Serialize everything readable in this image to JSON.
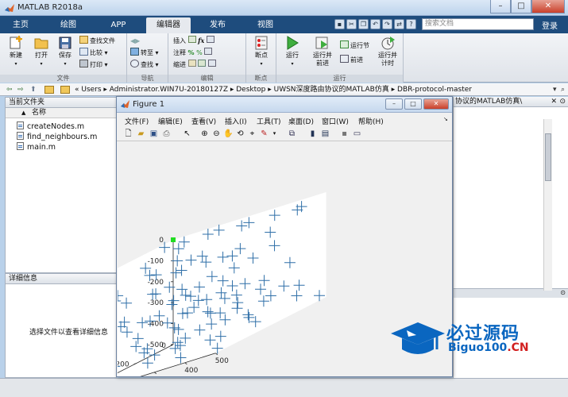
{
  "window": {
    "title": "MATLAB R2018a"
  },
  "tabs": [
    {
      "label": "主页"
    },
    {
      "label": "绘图"
    },
    {
      "label": "APP"
    },
    {
      "label": "编辑器"
    },
    {
      "label": "发布"
    },
    {
      "label": "视图"
    }
  ],
  "search": {
    "placeholder": "搜索文档"
  },
  "login_label": "登录",
  "ribbon": {
    "file_group": {
      "label": "文件",
      "new_label": "新建",
      "open_label": "打开",
      "save_label": "保存",
      "find_files_label": "查找文件",
      "compare_label": "比较",
      "print_label": "打印"
    },
    "nav_group": {
      "label": "导航",
      "goto_label": "转至",
      "find_label": "查找"
    },
    "edit_group": {
      "label": "编辑",
      "insert_label": "插入",
      "comment_label": "注释",
      "indent_label": "缩进"
    },
    "breakpoints_group": {
      "label": "断点",
      "breakpoints_label": "断点"
    },
    "run_group": {
      "label": "运行",
      "run_label": "运行",
      "run_advance_label": "运行并\n前进",
      "run_section_label": "运行节",
      "advance_label": "前进",
      "run_time_label": "运行并\n计时"
    }
  },
  "address": {
    "path": "« Users ▸ Administrator.WIN7U-20180127Z ▸ Desktop ▸ UWSN深度路由协议的MATLAB仿真 ▸ DBR-protocol-master"
  },
  "current_folder": {
    "title": "当前文件夹",
    "column_name": "名称",
    "sort_indicator": "▲",
    "files": [
      "createNodes.m",
      "find_neighbours.m",
      "main.m"
    ]
  },
  "details": {
    "title": "详细信息",
    "hint": "选择文件以查看详细信息"
  },
  "editor": {
    "tab_title": "协议的MATLAB仿真\\"
  },
  "figure": {
    "title": "Figure 1",
    "menu": [
      "文件(F)",
      "编辑(E)",
      "查看(V)",
      "插入(I)",
      "工具(T)",
      "桌面(D)",
      "窗口(W)",
      "帮助(H)"
    ]
  },
  "chart_data": {
    "type": "scatter",
    "projection": "3d",
    "marker": "+",
    "color": "#2f6fa8",
    "highlight_color": "#22dd22",
    "axes": {
      "x": {
        "ticks": [
          0,
          100,
          200,
          300,
          400,
          500
        ],
        "range": [
          0,
          500
        ]
      },
      "y": {
        "ticks": [
          0,
          200,
          400,
          600
        ],
        "range": [
          0,
          600
        ]
      },
      "z": {
        "ticks": [
          0,
          -100,
          -200,
          -300,
          -400,
          -500
        ],
        "range": [
          -500,
          0
        ]
      }
    },
    "grid": false,
    "points": [
      [
        20,
        80,
        -10
      ],
      [
        60,
        40,
        -20
      ],
      [
        90,
        120,
        -30
      ],
      [
        150,
        60,
        -15
      ],
      [
        210,
        100,
        -5
      ],
      [
        260,
        60,
        -25
      ],
      [
        320,
        120,
        -10
      ],
      [
        380,
        80,
        -20
      ],
      [
        430,
        40,
        -35
      ],
      [
        480,
        100,
        -15
      ],
      [
        30,
        200,
        -60
      ],
      [
        80,
        260,
        -90
      ],
      [
        140,
        210,
        -70
      ],
      [
        190,
        300,
        -110
      ],
      [
        240,
        240,
        -80
      ],
      [
        300,
        320,
        -100
      ],
      [
        350,
        260,
        -120
      ],
      [
        400,
        300,
        -90
      ],
      [
        450,
        220,
        -70
      ],
      [
        500,
        280,
        -130
      ],
      [
        40,
        380,
        -140
      ],
      [
        100,
        420,
        -160
      ],
      [
        160,
        360,
        -170
      ],
      [
        210,
        460,
        -150
      ],
      [
        270,
        400,
        -180
      ],
      [
        330,
        480,
        -200
      ],
      [
        380,
        420,
        -160
      ],
      [
        440,
        460,
        -190
      ],
      [
        490,
        380,
        -140
      ],
      [
        20,
        520,
        -210
      ],
      [
        70,
        560,
        -230
      ],
      [
        130,
        500,
        -250
      ],
      [
        190,
        580,
        -220
      ],
      [
        250,
        540,
        -260
      ],
      [
        310,
        590,
        -240
      ],
      [
        360,
        520,
        -280
      ],
      [
        420,
        560,
        -230
      ],
      [
        470,
        500,
        -270
      ],
      [
        60,
        120,
        -200
      ],
      [
        110,
        180,
        -260
      ],
      [
        170,
        140,
        -240
      ],
      [
        230,
        200,
        -300
      ],
      [
        290,
        160,
        -280
      ],
      [
        340,
        220,
        -320
      ],
      [
        400,
        170,
        -300
      ],
      [
        460,
        130,
        -260
      ],
      [
        30,
        300,
        -320
      ],
      [
        90,
        340,
        -360
      ],
      [
        150,
        280,
        -340
      ],
      [
        210,
        320,
        -380
      ],
      [
        270,
        260,
        -350
      ],
      [
        330,
        340,
        -400
      ],
      [
        390,
        300,
        -370
      ],
      [
        450,
        340,
        -410
      ],
      [
        500,
        300,
        -360
      ],
      [
        50,
        460,
        -400
      ],
      [
        110,
        500,
        -430
      ],
      [
        170,
        440,
        -420
      ],
      [
        230,
        520,
        -460
      ],
      [
        290,
        470,
        -440
      ],
      [
        350,
        540,
        -480
      ],
      [
        410,
        480,
        -450
      ],
      [
        470,
        540,
        -490
      ],
      [
        20,
        40,
        -300
      ],
      [
        80,
        20,
        -350
      ],
      [
        140,
        30,
        -400
      ],
      [
        200,
        50,
        -450
      ],
      [
        260,
        20,
        -480
      ],
      [
        320,
        40,
        -420
      ],
      [
        380,
        30,
        -380
      ],
      [
        440,
        60,
        -440
      ],
      [
        490,
        20,
        -480
      ],
      [
        120,
        580,
        -300
      ],
      [
        240,
        600,
        -350
      ],
      [
        360,
        590,
        -320
      ],
      [
        60,
        240,
        -440
      ],
      [
        180,
        260,
        -470
      ],
      [
        300,
        240,
        -490
      ],
      [
        420,
        250,
        -470
      ],
      [
        100,
        100,
        -470
      ],
      [
        220,
        110,
        -400
      ],
      [
        340,
        90,
        -350
      ],
      [
        460,
        80,
        -390
      ],
      [
        140,
        400,
        -280
      ],
      [
        260,
        380,
        -300
      ],
      [
        380,
        370,
        -260
      ],
      [
        60,
        600,
        -120
      ],
      [
        180,
        600,
        -80
      ],
      [
        300,
        590,
        -40
      ],
      [
        420,
        600,
        -20
      ],
      [
        500,
        560,
        -60
      ],
      [
        500,
        440,
        -240
      ],
      [
        20,
        460,
        -60
      ],
      [
        250,
        320,
        -240
      ],
      [
        320,
        200,
        -190
      ],
      [
        160,
        220,
        -120
      ],
      [
        280,
        440,
        -420
      ],
      [
        400,
        520,
        -380
      ],
      [
        120,
        300,
        -470
      ],
      [
        440,
        380,
        -330
      ]
    ],
    "highlight": [
      [
        0,
        0,
        0
      ]
    ]
  },
  "watermark": {
    "cn": "必过源码",
    "en": "Biguo100",
    "en_suffix": ".CN"
  }
}
